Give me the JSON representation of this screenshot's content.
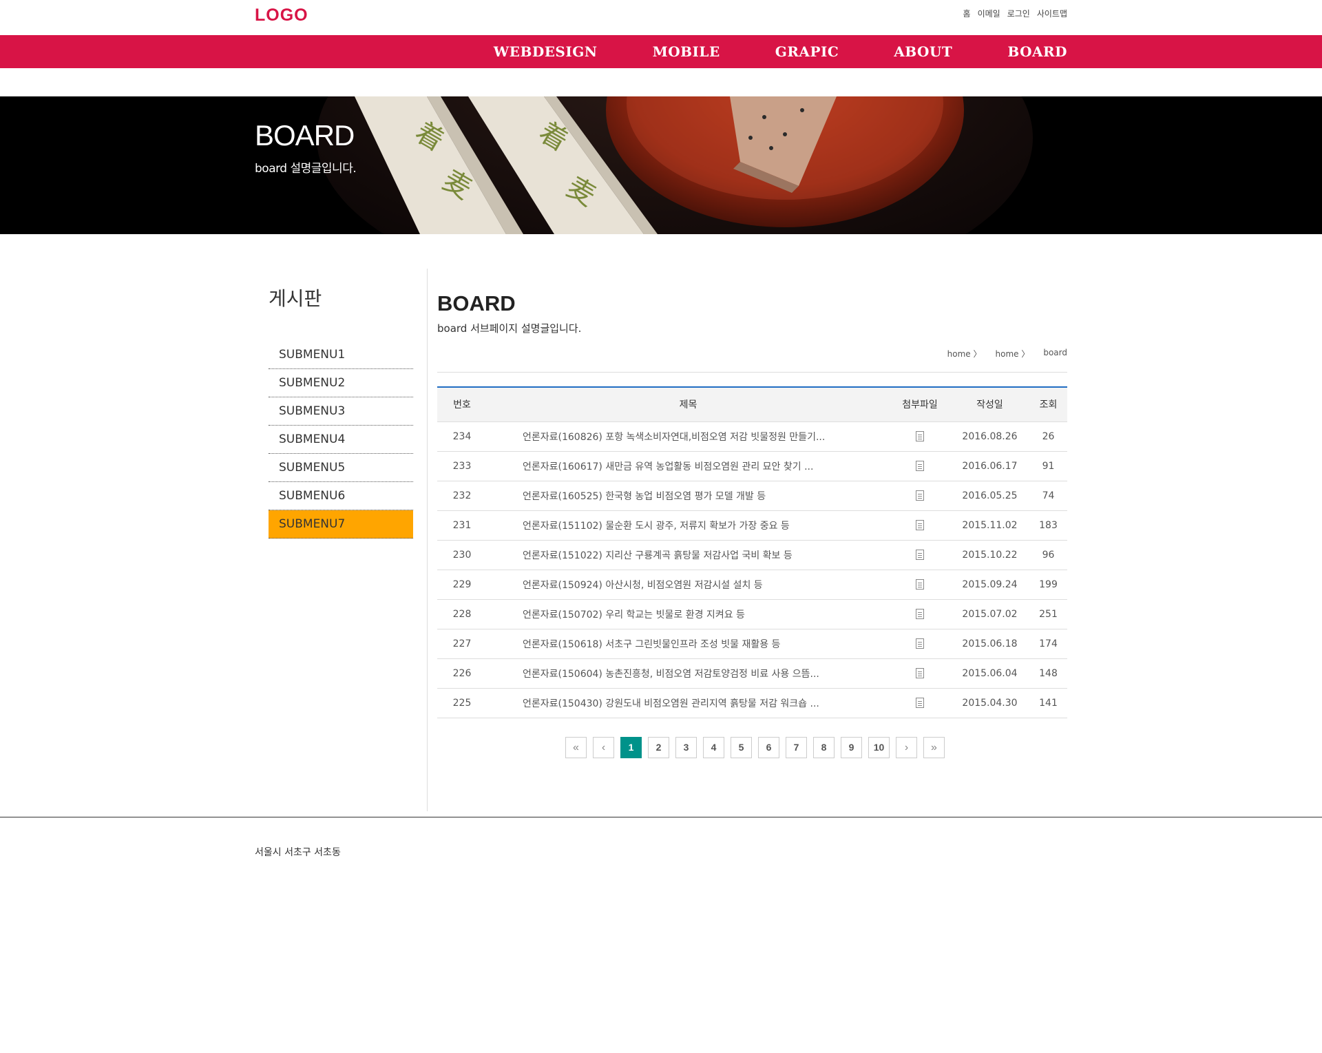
{
  "header": {
    "logo": "LOGO",
    "util_links": [
      "홈",
      "이메일",
      "로그인",
      "사이트맵"
    ],
    "gnb": [
      "WEBDESIGN",
      "MOBILE",
      "GRAPIC",
      "ABOUT",
      "BOARD"
    ]
  },
  "visual": {
    "title": "BOARD",
    "desc": "board 설명글입니다."
  },
  "lnb": {
    "title": "게시판",
    "items": [
      "SUBMENU1",
      "SUBMENU2",
      "SUBMENU3",
      "SUBMENU4",
      "SUBMENU5",
      "SUBMENU6",
      "SUBMENU7"
    ],
    "active_index": 6
  },
  "content": {
    "title": "BOARD",
    "desc": "board 서브페이지 설명글입니다.",
    "breadcrumb": [
      "home 〉",
      "home 〉",
      "board"
    ]
  },
  "board": {
    "headers": [
      "번호",
      "제목",
      "첨부파일",
      "작성일",
      "조회"
    ],
    "rows": [
      {
        "num": "234",
        "subject": "언론자료(160826) 포항 녹색소비자연대,비점오염 저감 빗물정원 만들기...",
        "date": "2016.08.26",
        "views": "26"
      },
      {
        "num": "233",
        "subject": "언론자료(160617) 새만금 유역 농업활동 비점오염원 관리 묘안 찾기 ...",
        "date": "2016.06.17",
        "views": "91"
      },
      {
        "num": "232",
        "subject": "언론자료(160525) 한국형 농업 비점오염 평가 모델 개발 등",
        "date": "2016.05.25",
        "views": "74"
      },
      {
        "num": "231",
        "subject": "언론자료(151102) 물순환 도시 광주, 저류지 확보가 가장 중요 등",
        "date": "2015.11.02",
        "views": "183"
      },
      {
        "num": "230",
        "subject": "언론자료(151022) 지리산 구룡계곡 흙탕물 저감사업 국비 확보 등",
        "date": "2015.10.22",
        "views": "96"
      },
      {
        "num": "229",
        "subject": "언론자료(150924) 아산시청, 비점오염원 저감시설 설치 등",
        "date": "2015.09.24",
        "views": "199"
      },
      {
        "num": "228",
        "subject": "언론자료(150702) 우리 학교는 빗물로 환경 지켜요 등",
        "date": "2015.07.02",
        "views": "251"
      },
      {
        "num": "227",
        "subject": "언론자료(150618) 서초구 그린빗물인프라 조성 빗물 재활용 등",
        "date": "2015.06.18",
        "views": "174"
      },
      {
        "num": "226",
        "subject": "언론자료(150604) 농촌진흥청, 비점오염 저감토양검정 비료 사용 으뜸...",
        "date": "2015.06.04",
        "views": "148"
      },
      {
        "num": "225",
        "subject": "언론자료(150430) 강원도내 비점오염원 관리지역 흙탕물 저감 워크숍 ...",
        "date": "2015.04.30",
        "views": "141"
      }
    ]
  },
  "paging": {
    "first": "«",
    "prev": "‹",
    "pages": [
      "1",
      "2",
      "3",
      "4",
      "5",
      "6",
      "7",
      "8",
      "9",
      "10"
    ],
    "current": "1",
    "next": "›",
    "last": "»"
  },
  "footer": {
    "address": "서울시 서초구 서초동"
  },
  "colors": {
    "brand": "#d81446",
    "lnb_active": "#ffa500",
    "paging_active": "#00928a",
    "table_top_border": "#1f6dc3"
  }
}
